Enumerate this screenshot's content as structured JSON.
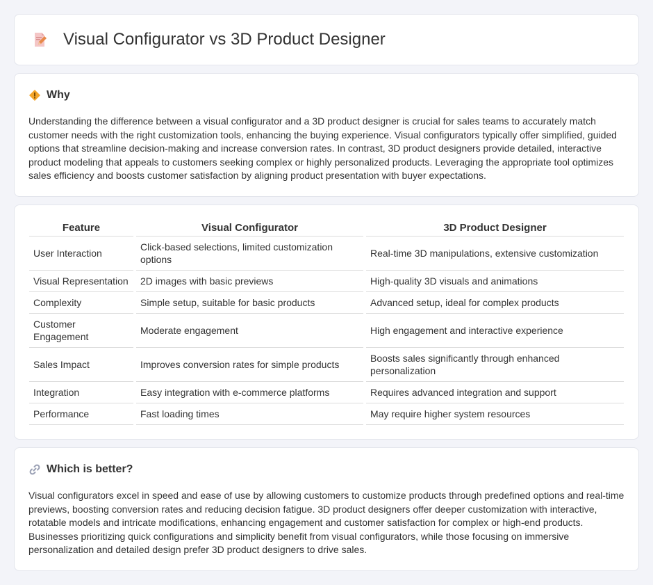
{
  "header": {
    "title": "Visual Configurator vs 3D Product Designer",
    "icon": "document-pencil-icon"
  },
  "why": {
    "heading": "Why",
    "icon": "diamond-warning-icon",
    "text": "Understanding the difference between a visual configurator and a 3D product designer is crucial for sales teams to accurately match customer needs with the right customization tools, enhancing the buying experience. Visual configurators typically offer simplified, guided options that streamline decision-making and increase conversion rates. In contrast, 3D product designers provide detailed, interactive product modeling that appeals to customers seeking complex or highly personalized products. Leveraging the appropriate tool optimizes sales efficiency and boosts customer satisfaction by aligning product presentation with buyer expectations."
  },
  "table": {
    "headers": [
      "Feature",
      "Visual Configurator",
      "3D Product Designer"
    ],
    "rows": [
      [
        "User Interaction",
        "Click-based selections, limited customization options",
        "Real-time 3D manipulations, extensive customization"
      ],
      [
        "Visual Representation",
        "2D images with basic previews",
        "High-quality 3D visuals and animations"
      ],
      [
        "Complexity",
        "Simple setup, suitable for basic products",
        "Advanced setup, ideal for complex products"
      ],
      [
        "Customer Engagement",
        "Moderate engagement",
        "High engagement and interactive experience"
      ],
      [
        "Sales Impact",
        "Improves conversion rates for simple products",
        "Boosts sales significantly through enhanced personalization"
      ],
      [
        "Integration",
        "Easy integration with e-commerce platforms",
        "Requires advanced integration and support"
      ],
      [
        "Performance",
        "Fast loading times",
        "May require higher system resources"
      ]
    ]
  },
  "better": {
    "heading": "Which is better?",
    "icon": "link-icon",
    "text": "Visual configurators excel in speed and ease of use by allowing customers to customize products through predefined options and real-time previews, boosting conversion rates and reducing decision fatigue. 3D product designers offer deeper customization with interactive, rotatable models and intricate modifications, enhancing engagement and customer satisfaction for complex or high-end products. Businesses prioritizing quick configurations and simplicity benefit from visual configurators, while those focusing on immersive personalization and detailed design prefer 3D product designers to drive sales."
  }
}
